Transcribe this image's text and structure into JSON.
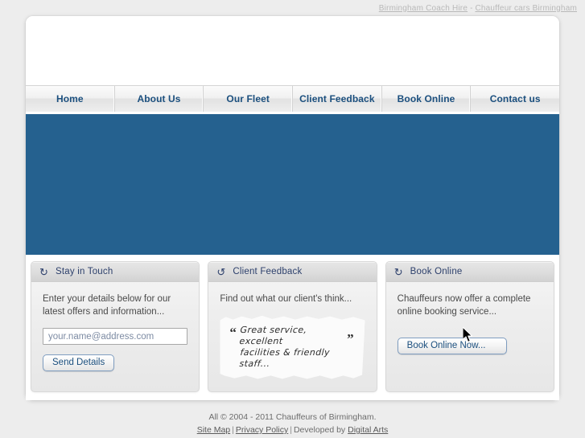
{
  "topbar": {
    "link1": "Birmingham Coach Hire",
    "separator": "-",
    "link2": "Chauffeur cars Birmingham"
  },
  "nav": {
    "items": [
      {
        "label": "Home"
      },
      {
        "label": "About Us"
      },
      {
        "label": "Our Fleet"
      },
      {
        "label": "Client Feedback"
      },
      {
        "label": "Book Online"
      },
      {
        "label": "Contact us"
      }
    ]
  },
  "banner": {
    "color": "#25618f"
  },
  "panels": [
    {
      "icon": "refresh-circular-arrow-icon",
      "icon_glyph": "↻",
      "title": "Stay in Touch",
      "body_text": "Enter your details below for our latest offers and information...",
      "input_placeholder": "your.name@address.com",
      "input_value": "",
      "button_label": "Send Details"
    },
    {
      "icon": "loop-arrow-icon",
      "icon_glyph": "↺",
      "title": "Client Feedback",
      "body_text": "Find out what our client's think...",
      "quote_open": "“",
      "quote_close": "”",
      "quote_line1": "Great service, excellent",
      "quote_line2": "facilities & friendly staff..."
    },
    {
      "icon": "reload-circular-arrow-icon",
      "icon_glyph": "↻",
      "title": "Book Online",
      "body_text": "Chauffeurs now offer a complete online booking service...",
      "button_label": "Book Online Now..."
    }
  ],
  "footer": {
    "copyright": "All © 2004 - 2011 Chauffeurs of Birmingham.",
    "sitemap": "Site Map",
    "divider1": "|",
    "privacy": "Privacy Policy",
    "divider2": "|",
    "developed_by": "Developed by",
    "agency": "Digital Arts"
  },
  "accent": {
    "nav_text": "#1b4f7e",
    "panel_title": "#2c3f6b",
    "banner_blue": "#25618f"
  }
}
